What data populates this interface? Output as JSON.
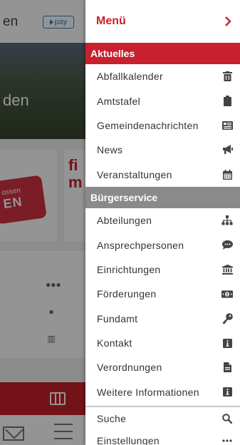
{
  "background": {
    "title_fragment": "en",
    "pay_label": "pay",
    "hero_text": "den",
    "ticket_text_1": "ossen",
    "ticket_text_2": "EN",
    "card2_text": "fi m"
  },
  "drawer": {
    "title": "Menü",
    "sections": [
      {
        "title": "Aktuelles",
        "color": "#c8202e",
        "items": [
          {
            "label": "Abfallkalender",
            "icon": "trash-icon"
          },
          {
            "label": "Amtstafel",
            "icon": "clipboard-icon"
          },
          {
            "label": "Gemeindenachrichten",
            "icon": "newspaper-icon"
          },
          {
            "label": "News",
            "icon": "megaphone-icon"
          },
          {
            "label": "Veranstaltungen",
            "icon": "calendar-icon"
          }
        ]
      },
      {
        "title": "Bürgerservice",
        "color": "#8a8a8a",
        "items": [
          {
            "label": "Abteilungen",
            "icon": "sitemap-icon"
          },
          {
            "label": "Ansprechpersonen",
            "icon": "chat-icon"
          },
          {
            "label": "Einrichtungen",
            "icon": "building-icon"
          },
          {
            "label": "Förderungen",
            "icon": "money-icon"
          },
          {
            "label": "Fundamt",
            "icon": "key-icon"
          },
          {
            "label": "Kontakt",
            "icon": "info-icon"
          },
          {
            "label": "Verordnungen",
            "icon": "document-icon"
          },
          {
            "label": "Weitere Informationen",
            "icon": "info-icon"
          }
        ]
      }
    ],
    "bottom_items": [
      {
        "label": "Suche",
        "icon": "search-icon"
      },
      {
        "label": "Einstellungen",
        "icon": "more-icon"
      }
    ]
  },
  "colors": {
    "accent": "#c8202e",
    "section_grey": "#8a8a8a",
    "text": "#333333",
    "icon": "#444444"
  }
}
